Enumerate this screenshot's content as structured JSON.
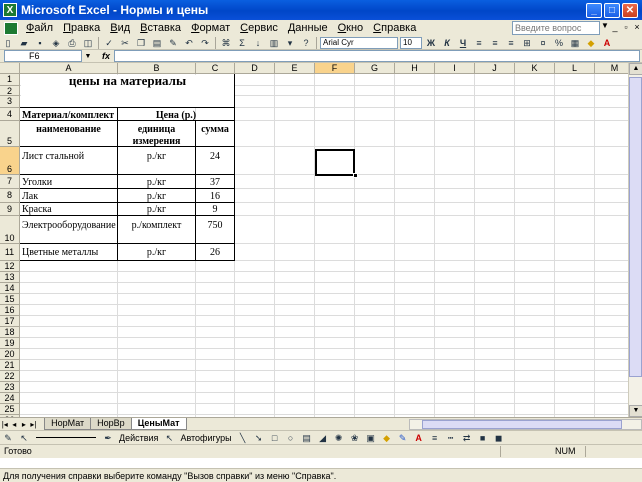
{
  "window": {
    "title": "Microsoft Excel - Нормы и цены",
    "app_icon": "X"
  },
  "menu": {
    "items": [
      "Файл",
      "Правка",
      "Вид",
      "Вставка",
      "Формат",
      "Сервис",
      "Данные",
      "Окно",
      "Справка"
    ],
    "help_placeholder": "Введите вопрос"
  },
  "toolbar": {
    "font": "Arial Cyr",
    "size": "10",
    "bold": "Ж",
    "italic": "К",
    "underline": "Ч",
    "percent": "%",
    "autosum": "Σ"
  },
  "formula_bar": {
    "name_box": "F6",
    "fx": "fx"
  },
  "columns": [
    "A",
    "B",
    "C",
    "D",
    "E",
    "F",
    "G",
    "H",
    "I",
    "J",
    "K",
    "L",
    "M"
  ],
  "rows": [
    "1",
    "2",
    "3",
    "4",
    "5",
    "6",
    "7",
    "8",
    "9",
    "10",
    "11",
    "12",
    "13",
    "14",
    "15",
    "16",
    "17",
    "18",
    "19",
    "20",
    "21",
    "22",
    "23",
    "24",
    "25",
    "26"
  ],
  "sheet": {
    "title": "цены на материалы",
    "header_material": "Материал/комплект",
    "header_price": "Цена (р.)",
    "sub_name": "наименование",
    "sub_unit": "единица измерения",
    "sub_sum": "сумма",
    "items": [
      {
        "name": "Лист стальной",
        "unit": "р./кг",
        "sum": "24"
      },
      {
        "name": "Уголки",
        "unit": "р./кг",
        "sum": "37"
      },
      {
        "name": "Лак",
        "unit": "р./кг",
        "sum": "16"
      },
      {
        "name": "Краска",
        "unit": "р./кг",
        "sum": "9"
      },
      {
        "name": "Электрооборудование",
        "unit": "р./комплект",
        "sum": "750"
      },
      {
        "name": "Цветные металлы",
        "unit": "р./кг",
        "sum": "26"
      }
    ]
  },
  "tabs": [
    "НорМат",
    "НорВр",
    "ЦеныМат"
  ],
  "draw_toolbar": {
    "actions": "Действия",
    "autoshapes": "Автофигуры"
  },
  "status": {
    "ready": "Готово",
    "num": "NUM"
  },
  "help_status": "Для получения справки выберите команду \"Вызов справки\" из меню \"Справка\"."
}
